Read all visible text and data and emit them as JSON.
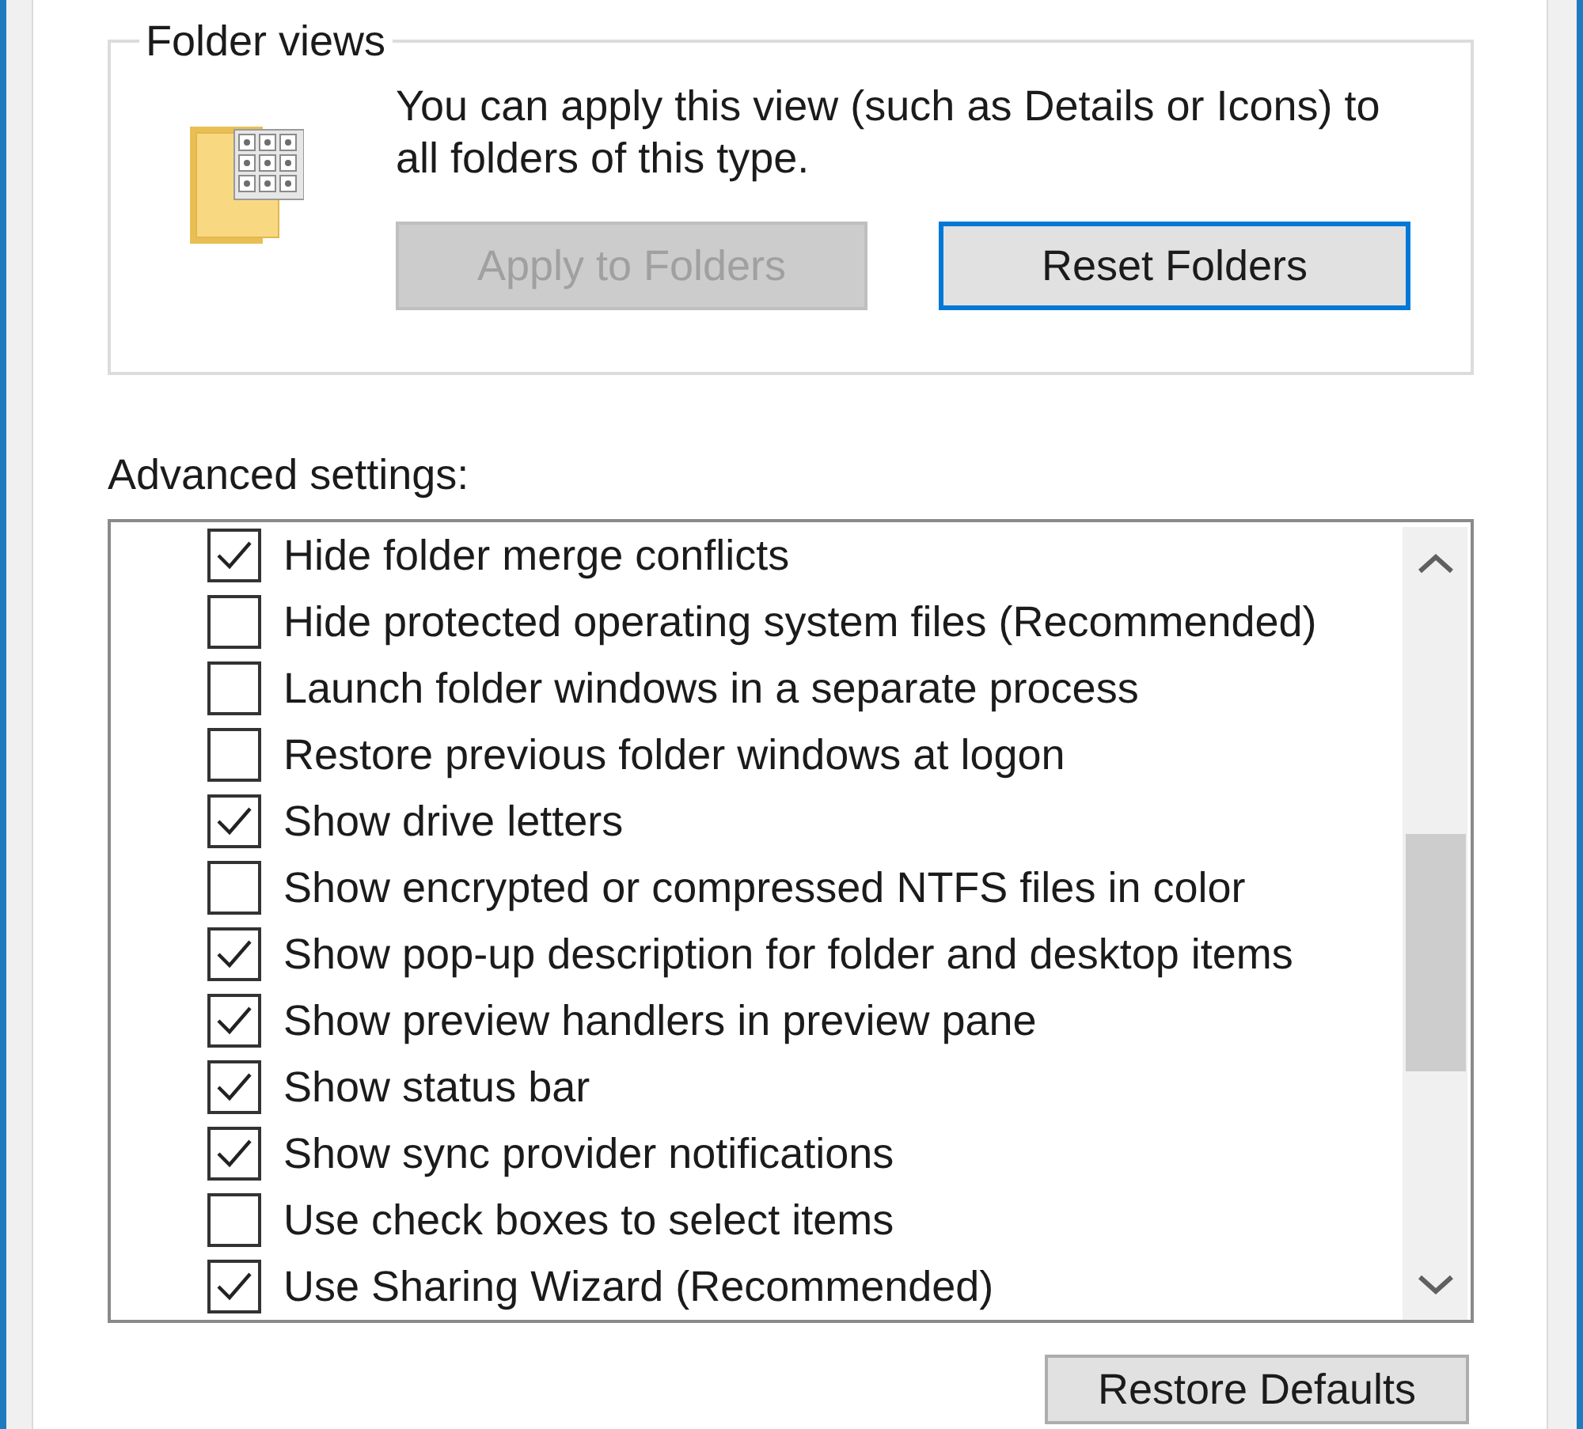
{
  "folder_views": {
    "title": "Folder views",
    "description": "You can apply this view (such as Details or Icons) to all folders of this type.",
    "buttons": [
      {
        "label": "Apply to Folders",
        "disabled": true,
        "focused": false
      },
      {
        "label": "Reset Folders",
        "disabled": false,
        "focused": true
      }
    ]
  },
  "advanced_settings": {
    "label": "Advanced settings:",
    "items": [
      {
        "label": "Hide folder merge conflicts",
        "checked": true
      },
      {
        "label": "Hide protected operating system files (Recommended)",
        "checked": false
      },
      {
        "label": "Launch folder windows in a separate process",
        "checked": false
      },
      {
        "label": "Restore previous folder windows at logon",
        "checked": false
      },
      {
        "label": "Show drive letters",
        "checked": true
      },
      {
        "label": "Show encrypted or compressed NTFS files in color",
        "checked": false
      },
      {
        "label": "Show pop-up description for folder and desktop items",
        "checked": true
      },
      {
        "label": "Show preview handlers in preview pane",
        "checked": true
      },
      {
        "label": "Show status bar",
        "checked": true
      },
      {
        "label": "Show sync provider notifications",
        "checked": true
      },
      {
        "label": "Use check boxes to select items",
        "checked": false
      },
      {
        "label": "Use Sharing Wizard (Recommended)",
        "checked": true
      }
    ]
  },
  "footer_buttons": [
    {
      "label": "Restore Defaults"
    }
  ]
}
